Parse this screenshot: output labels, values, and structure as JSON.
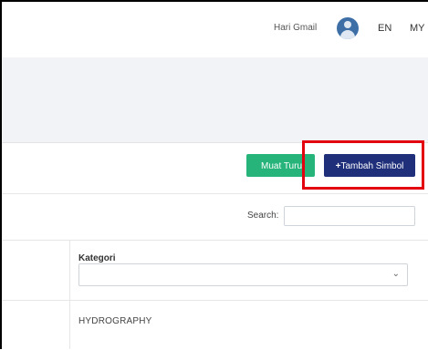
{
  "topbar": {
    "user_name": "Hari Gmail",
    "lang_en": "EN",
    "lang_my": "MY"
  },
  "toolbar": {
    "green_button_label": "Muat Turu",
    "add_symbol_plus": "+",
    "add_symbol_label": "Tambah Simbol",
    "colors": {
      "green": "#26b47a",
      "blue": "#1f2f7a",
      "highlight": "#e3000f"
    }
  },
  "search": {
    "label": "Search:",
    "value": ""
  },
  "table": {
    "columns": [
      "Kategori"
    ],
    "filter_value": "",
    "rows": [
      {
        "kategori": "HYDROGRAPHY"
      }
    ]
  },
  "icons": {
    "avatar": "user-avatar-icon",
    "chevron": "chevron-down-icon"
  }
}
